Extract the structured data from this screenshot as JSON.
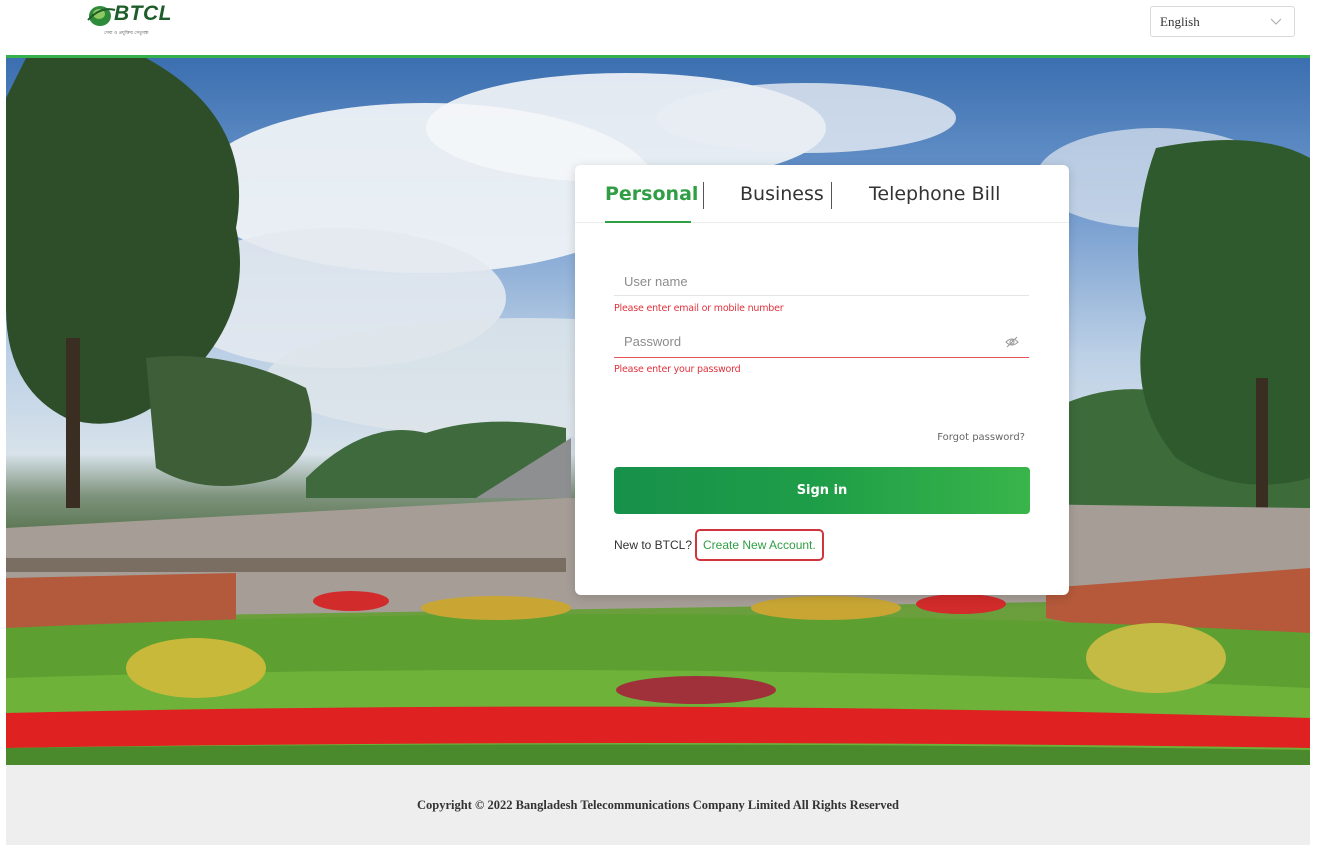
{
  "header": {
    "logo_text": "BTCL",
    "logo_tagline": "সেবা ও প্রযুক্তির সেতুবন্ধ",
    "language": "English"
  },
  "login": {
    "tabs": [
      {
        "label": "Personal",
        "active": true
      },
      {
        "label": "Business",
        "active": false
      },
      {
        "label": "Telephone Bill",
        "active": false
      }
    ],
    "username_placeholder": "User name",
    "username_error": "Please enter email or mobile number",
    "password_placeholder": "Password",
    "password_error": "Please enter your password",
    "forgot_label": "Forgot password?",
    "signin_label": "Sign in",
    "new_to_label": "New to BTCL?",
    "create_account_label": "Create New Account."
  },
  "footer": {
    "copyright": "Copyright © 2022 Bangladesh Telecommunications Company Limited All Rights Reserved"
  },
  "colors": {
    "brand_green": "#2f9e44",
    "error_red": "#e0323c",
    "accent_line": "#35b04a"
  }
}
